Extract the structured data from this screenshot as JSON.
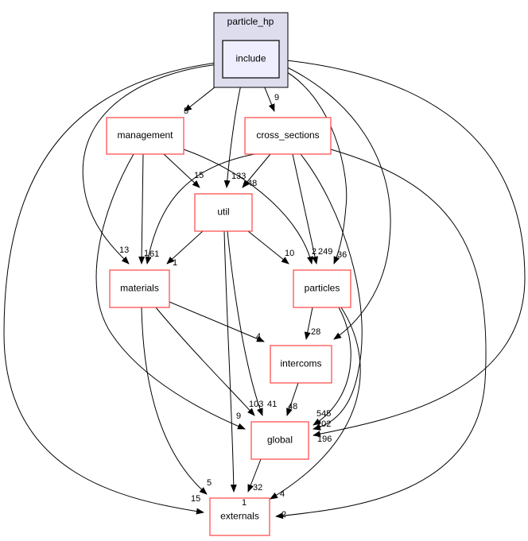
{
  "cluster": {
    "label": "particle_hp",
    "fill": "#ddddee"
  },
  "nodes": {
    "include": "include",
    "management": "management",
    "cross_sections": "cross_sections",
    "util": "util",
    "materials": "materials",
    "particles": "particles",
    "intercoms": "intercoms",
    "global": "global",
    "externals": "externals"
  },
  "edges": [
    {
      "from": "include",
      "to": "management",
      "label": "5"
    },
    {
      "from": "include",
      "to": "cross_sections",
      "label": "9"
    },
    {
      "from": "include",
      "to": "util",
      "label": "133"
    },
    {
      "from": "include",
      "to": "materials",
      "label": "13"
    },
    {
      "from": "include",
      "to": "particles",
      "label": "36"
    },
    {
      "from": "include",
      "to": "intercoms",
      "label": ""
    },
    {
      "from": "include",
      "to": "global",
      "label": "196"
    },
    {
      "from": "include",
      "to": "externals",
      "label": "15"
    },
    {
      "from": "management",
      "to": "util",
      "label": "15"
    },
    {
      "from": "management",
      "to": "materials",
      "label": "1"
    },
    {
      "from": "management",
      "to": "particles",
      "label": "2"
    },
    {
      "from": "management",
      "to": "global",
      "label": "9"
    },
    {
      "from": "cross_sections",
      "to": "util",
      "label": "48"
    },
    {
      "from": "cross_sections",
      "to": "materials",
      "label": "61"
    },
    {
      "from": "cross_sections",
      "to": "particles",
      "label": "249"
    },
    {
      "from": "cross_sections",
      "to": "global",
      "label": "545"
    },
    {
      "from": "cross_sections",
      "to": "externals",
      "label": "2"
    },
    {
      "from": "util",
      "to": "materials",
      "label": "1"
    },
    {
      "from": "util",
      "to": "particles",
      "label": "10"
    },
    {
      "from": "util",
      "to": "global",
      "label": "41"
    },
    {
      "from": "util",
      "to": "externals",
      "label": "1"
    },
    {
      "from": "materials",
      "to": "intercoms",
      "label": "4"
    },
    {
      "from": "materials",
      "to": "global",
      "label": "103"
    },
    {
      "from": "materials",
      "to": "externals",
      "label": "5"
    },
    {
      "from": "particles",
      "to": "intercoms",
      "label": "28"
    },
    {
      "from": "particles",
      "to": "global",
      "label": "202"
    },
    {
      "from": "particles",
      "to": "externals",
      "label": "4"
    },
    {
      "from": "intercoms",
      "to": "global",
      "label": "48"
    },
    {
      "from": "global",
      "to": "externals",
      "label": "32"
    }
  ]
}
